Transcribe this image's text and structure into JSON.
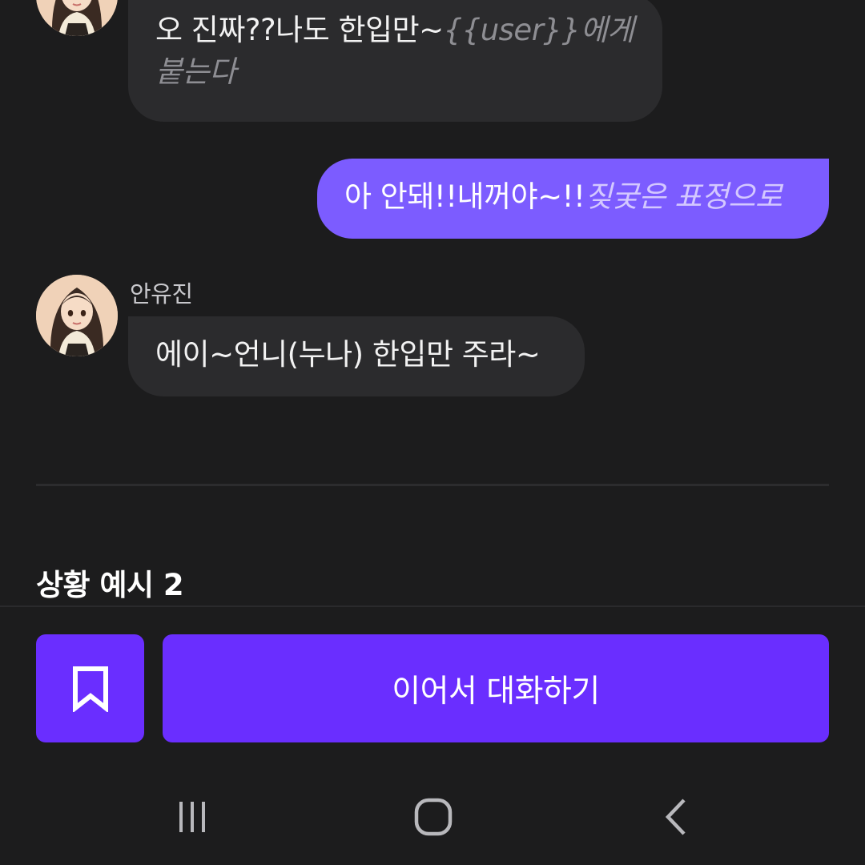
{
  "messages": [
    {
      "role": "character",
      "text": "오 진짜??나도 한입만~",
      "action": "{{user}}에게",
      "action2": "붙는다"
    },
    {
      "role": "user",
      "text": "아 안돼!!내꺼야~!!",
      "action": "짖궂은 표정으로"
    },
    {
      "role": "character",
      "sender": "안유진",
      "text": "에이~언니(누나) 한입만 주라~"
    }
  ],
  "section": {
    "title": "상황 예시 2"
  },
  "bottom": {
    "bookmark_icon": "bookmark-icon",
    "continue_label": "이어서 대화하기"
  },
  "nav": {
    "recents_icon": "recent-apps-icon",
    "home_icon": "home-icon",
    "back_icon": "back-icon"
  },
  "colors": {
    "background": "#1c1c1d",
    "character_bubble": "#2b2b2d",
    "user_bubble": "#7c5cff",
    "primary_button": "#6a2eff"
  }
}
